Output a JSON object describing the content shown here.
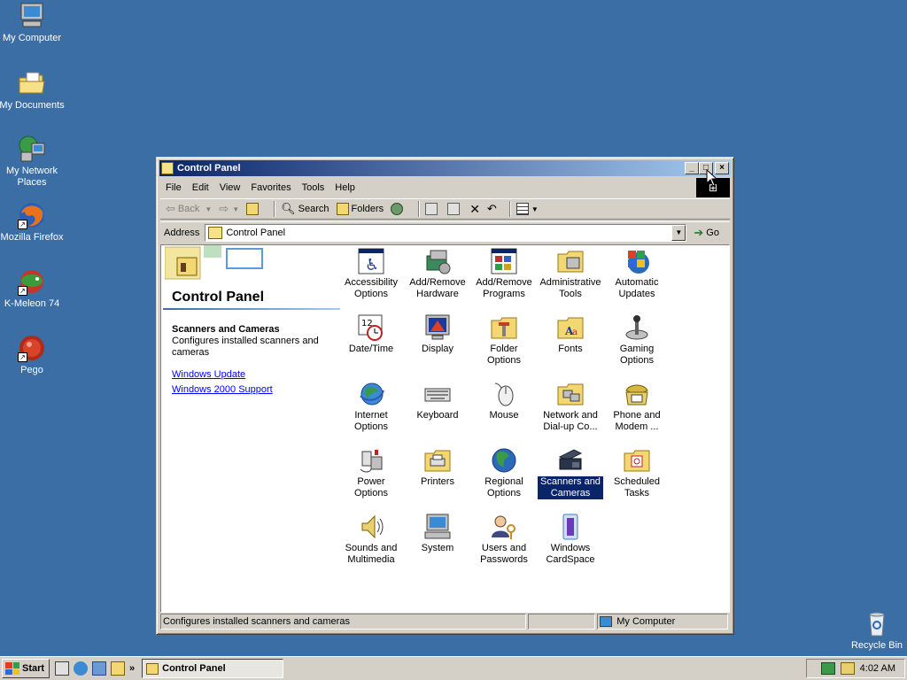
{
  "desktop": {
    "icons": [
      {
        "label": "My Computer",
        "icon": "computer-icon"
      },
      {
        "label": "My Documents",
        "icon": "folder-icon"
      },
      {
        "label": "My Network Places",
        "icon": "network-icon"
      },
      {
        "label": "Mozilla Firefox",
        "icon": "firefox-icon"
      },
      {
        "label": "K-Meleon 74",
        "icon": "kmeleon-icon"
      },
      {
        "label": "Pego",
        "icon": "pego-icon"
      },
      {
        "label": "Recycle Bin",
        "icon": "recycle-bin-icon"
      }
    ]
  },
  "window": {
    "title": "Control Panel",
    "menu": [
      "File",
      "Edit",
      "View",
      "Favorites",
      "Tools",
      "Help"
    ],
    "toolbar": {
      "back": "Back",
      "search": "Search",
      "folders": "Folders"
    },
    "address": {
      "label": "Address",
      "value": "Control Panel",
      "go": "Go"
    },
    "left_pane": {
      "title": "Control Panel",
      "selected_title": "Scanners and Cameras",
      "selected_desc": "Configures installed scanners and cameras",
      "links": [
        "Windows Update",
        "Windows 2000 Support"
      ]
    },
    "items": [
      {
        "label": "Accessibility Options",
        "icon": "accessibility-icon"
      },
      {
        "label": "Add/Remove Hardware",
        "icon": "hardware-icon"
      },
      {
        "label": "Add/Remove Programs",
        "icon": "programs-icon"
      },
      {
        "label": "Administrative Tools",
        "icon": "admin-tools-icon"
      },
      {
        "label": "Automatic Updates",
        "icon": "updates-icon"
      },
      {
        "label": "Date/Time",
        "icon": "date-time-icon"
      },
      {
        "label": "Display",
        "icon": "display-icon"
      },
      {
        "label": "Folder Options",
        "icon": "folder-options-icon"
      },
      {
        "label": "Fonts",
        "icon": "fonts-icon"
      },
      {
        "label": "Gaming Options",
        "icon": "gaming-icon"
      },
      {
        "label": "Internet Options",
        "icon": "internet-icon"
      },
      {
        "label": "Keyboard",
        "icon": "keyboard-icon"
      },
      {
        "label": "Mouse",
        "icon": "mouse-icon"
      },
      {
        "label": "Network and Dial-up Co...",
        "icon": "network-dialup-icon"
      },
      {
        "label": "Phone and Modem ...",
        "icon": "phone-icon"
      },
      {
        "label": "Power Options",
        "icon": "power-icon"
      },
      {
        "label": "Printers",
        "icon": "printers-icon"
      },
      {
        "label": "Regional Options",
        "icon": "regional-icon"
      },
      {
        "label": "Scanners and Cameras",
        "icon": "scanner-icon"
      },
      {
        "label": "Scheduled Tasks",
        "icon": "scheduled-tasks-icon"
      },
      {
        "label": "Sounds and Multimedia",
        "icon": "sounds-icon"
      },
      {
        "label": "System",
        "icon": "system-icon"
      },
      {
        "label": "Users and Passwords",
        "icon": "users-icon"
      },
      {
        "label": "Windows CardSpace",
        "icon": "cardspace-icon"
      }
    ],
    "status": {
      "text": "Configures installed scanners and cameras",
      "zone": "My Computer"
    }
  },
  "taskbar": {
    "start": "Start",
    "task": "Control Panel",
    "clock": "4:02 AM"
  }
}
